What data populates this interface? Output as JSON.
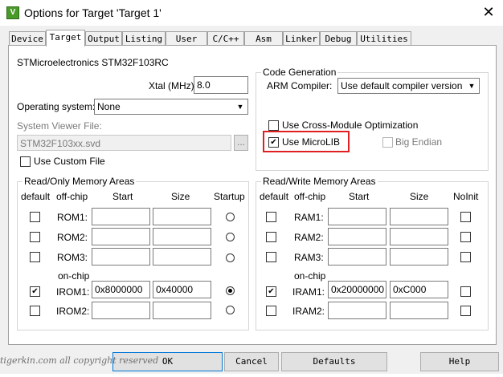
{
  "window": {
    "title": "Options for Target 'Target 1'",
    "app_icon": "keil-uvision-icon",
    "close_glyph": "✕"
  },
  "tabs": [
    {
      "label": "Device",
      "active": false
    },
    {
      "label": "Target",
      "active": true
    },
    {
      "label": "Output",
      "active": false
    },
    {
      "label": "Listing",
      "active": false
    },
    {
      "label": "User",
      "active": false
    },
    {
      "label": "C/C++",
      "active": false
    },
    {
      "label": "Asm",
      "active": false
    },
    {
      "label": "Linker",
      "active": false
    },
    {
      "label": "Debug",
      "active": false
    },
    {
      "label": "Utilities",
      "active": false
    }
  ],
  "device": {
    "name": "STMicroelectronics STM32F103RC"
  },
  "xtal": {
    "label": "Xtal (MHz):",
    "value": "8.0"
  },
  "os": {
    "label": "Operating system:",
    "value": "None"
  },
  "svd": {
    "label": "System Viewer File:",
    "value": "STM32F103xx.svd",
    "browse": "...",
    "custom_label": "Use Custom File",
    "custom_checked": false
  },
  "codegen": {
    "title": "Code Generation",
    "compiler_label": "ARM Compiler:",
    "compiler_value": "Use default compiler version",
    "cross_module_label": "Use Cross-Module Optimization",
    "cross_module_checked": false,
    "microlib_label": "Use MicroLIB",
    "microlib_checked": true,
    "big_endian_label": "Big Endian",
    "big_endian_checked": false,
    "highlight_color": "#e02020"
  },
  "ro_memory": {
    "title": "Read/Only Memory Areas",
    "headers": {
      "default": "default",
      "offchip": "off-chip",
      "start": "Start",
      "size": "Size",
      "last": "Startup"
    },
    "onchip_label": "on-chip",
    "rows": [
      {
        "name": "ROM1:",
        "default": false,
        "start": "",
        "size": "",
        "startup": false
      },
      {
        "name": "ROM2:",
        "default": false,
        "start": "",
        "size": "",
        "startup": false
      },
      {
        "name": "ROM3:",
        "default": false,
        "start": "",
        "size": "",
        "startup": false
      },
      {
        "name": "IROM1:",
        "default": true,
        "start": "0x8000000",
        "size": "0x40000",
        "startup": true
      },
      {
        "name": "IROM2:",
        "default": false,
        "start": "",
        "size": "",
        "startup": false
      }
    ]
  },
  "rw_memory": {
    "title": "Read/Write Memory Areas",
    "headers": {
      "default": "default",
      "offchip": "off-chip",
      "start": "Start",
      "size": "Size",
      "last": "NoInit"
    },
    "onchip_label": "on-chip",
    "rows": [
      {
        "name": "RAM1:",
        "default": false,
        "start": "",
        "size": "",
        "noinit": false
      },
      {
        "name": "RAM2:",
        "default": false,
        "start": "",
        "size": "",
        "noinit": false
      },
      {
        "name": "RAM3:",
        "default": false,
        "start": "",
        "size": "",
        "noinit": false
      },
      {
        "name": "IRAM1:",
        "default": true,
        "start": "0x20000000",
        "size": "0xC000",
        "noinit": false
      },
      {
        "name": "IRAM2:",
        "default": false,
        "start": "",
        "size": "",
        "noinit": false
      }
    ]
  },
  "buttons": {
    "ok": "OK",
    "cancel": "Cancel",
    "defaults": "Defaults",
    "help": "Help"
  },
  "watermark": "tigerkin.com all copyright reserved"
}
